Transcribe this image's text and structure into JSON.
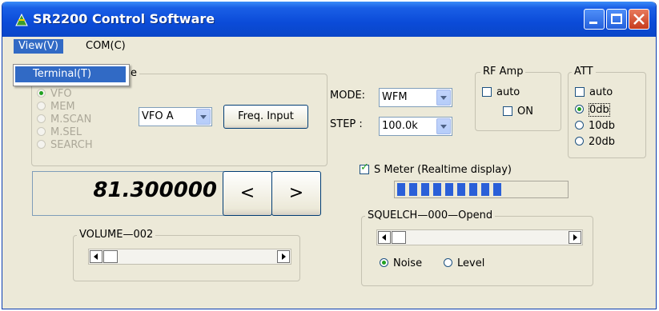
{
  "window": {
    "title": "SR2200 Control Software"
  },
  "menu": {
    "view": "View(V)",
    "com": "COM(C)",
    "dropdown_item": "Terminal(T)"
  },
  "mode_group": {
    "label_tail": "e",
    "options": [
      "VFO",
      "MEM",
      "M.SCAN",
      "M.SEL",
      "SEARCH"
    ],
    "selected": "VFO"
  },
  "vfo_combo": {
    "value": "VFO A"
  },
  "freq_input_button": "Freq. Input",
  "frequency": "81.300000",
  "prev_button": "<",
  "next_button": ">",
  "mode": {
    "label": "MODE:",
    "value": "WFM"
  },
  "step": {
    "label": "STEP :",
    "value": "100.0k"
  },
  "rf_amp": {
    "label": "RF Amp",
    "auto_label": "auto",
    "auto_checked": false,
    "on_label": "ON",
    "on_checked": false
  },
  "att": {
    "label": "ATT",
    "auto_label": "auto",
    "auto_checked": false,
    "options": [
      "0db",
      "10db",
      "20db"
    ],
    "selected": "0db"
  },
  "smeter": {
    "label": "S Meter  (Realtime display)",
    "checked": true,
    "level_segments": 9,
    "total_segments": 20
  },
  "squelch": {
    "label": "SQUELCH",
    "value": "000",
    "status": "Opend",
    "noise_label": "Noise",
    "level_label": "Level",
    "selected": "Noise"
  },
  "volume": {
    "label": "VOLUME",
    "value": "002"
  },
  "colors": {
    "title_blue": "#0b4bd8",
    "highlight": "#316ac5",
    "window_bg": "#ece9d8",
    "meter_blue": "#2a5fd8"
  }
}
